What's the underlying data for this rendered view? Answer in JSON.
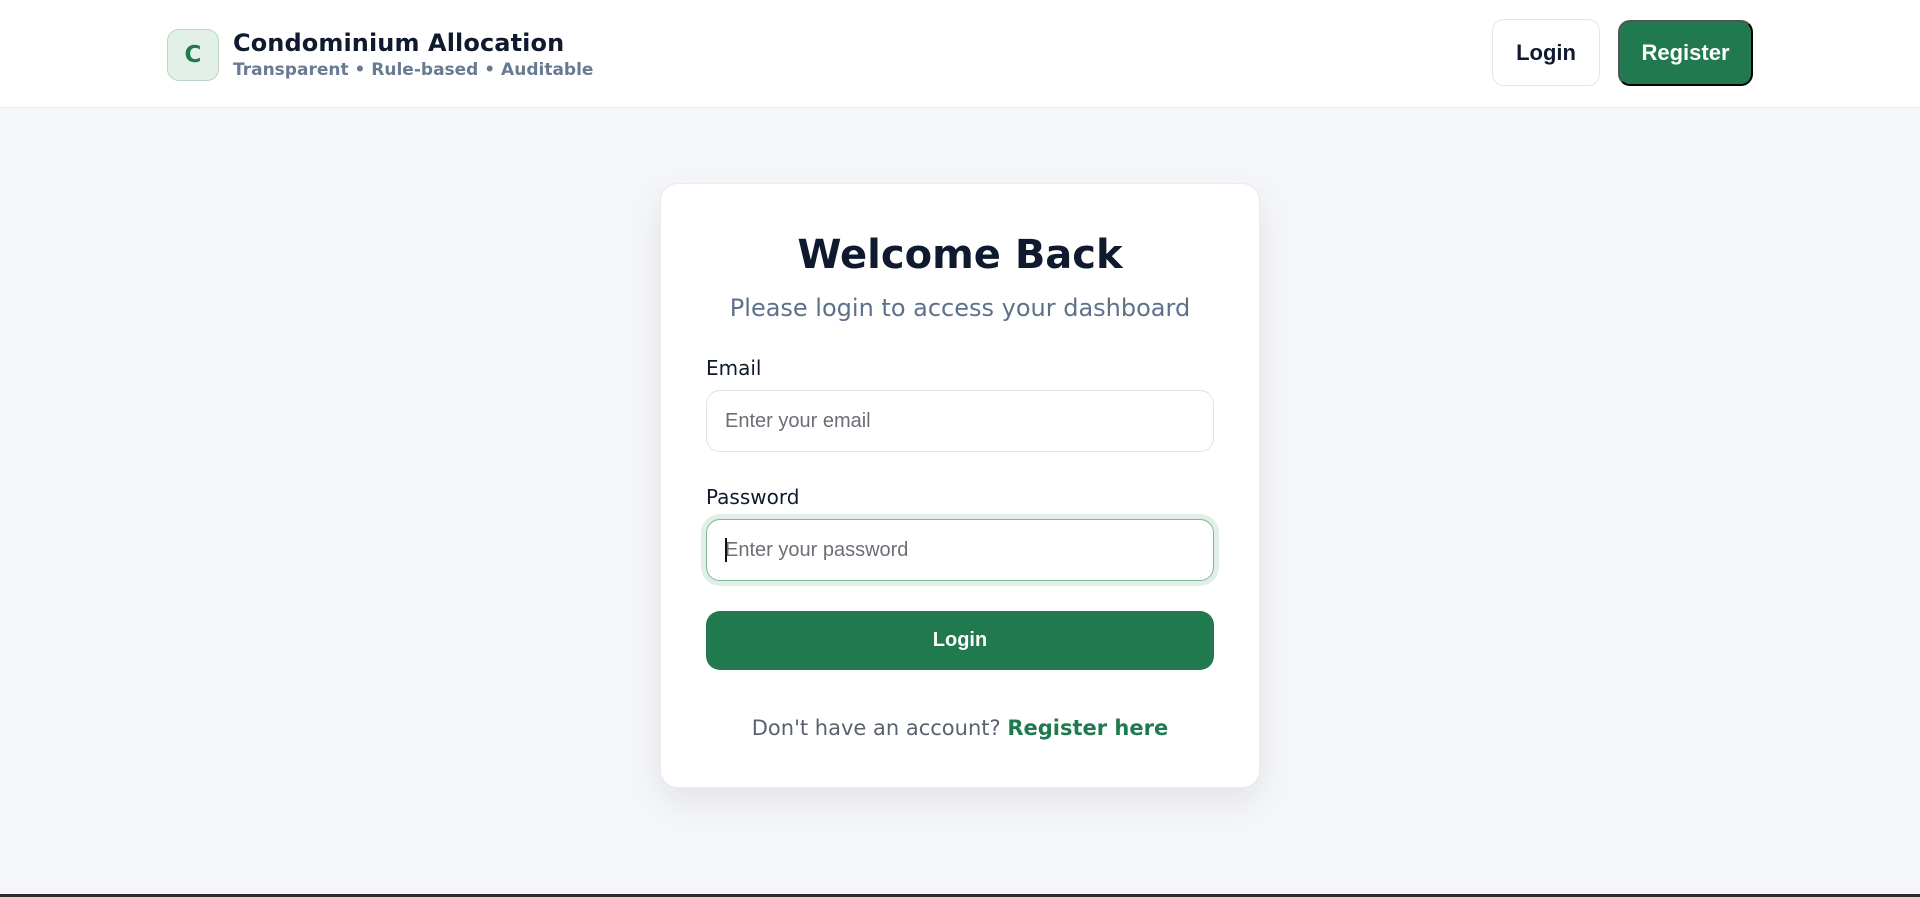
{
  "header": {
    "logo_letter": "C",
    "title": "Condominium Allocation",
    "tagline": "Transparent • Rule-based • Auditable",
    "login_label": "Login",
    "register_label": "Register"
  },
  "login_card": {
    "title": "Welcome Back",
    "subtitle": "Please login to access your dashboard",
    "email_label": "Email",
    "email_placeholder": "Enter your email",
    "email_value": "",
    "password_label": "Password",
    "password_placeholder": "Enter your password",
    "password_value": "",
    "submit_label": "Login",
    "no_account_text": "Don't have an account?",
    "register_link_text": "Register here"
  },
  "colors": {
    "brand_green": "#217a4f",
    "page_background": "#f5f6f9",
    "heading_text": "#0f1a2e",
    "muted_text": "#5f708a"
  },
  "focus": "password"
}
